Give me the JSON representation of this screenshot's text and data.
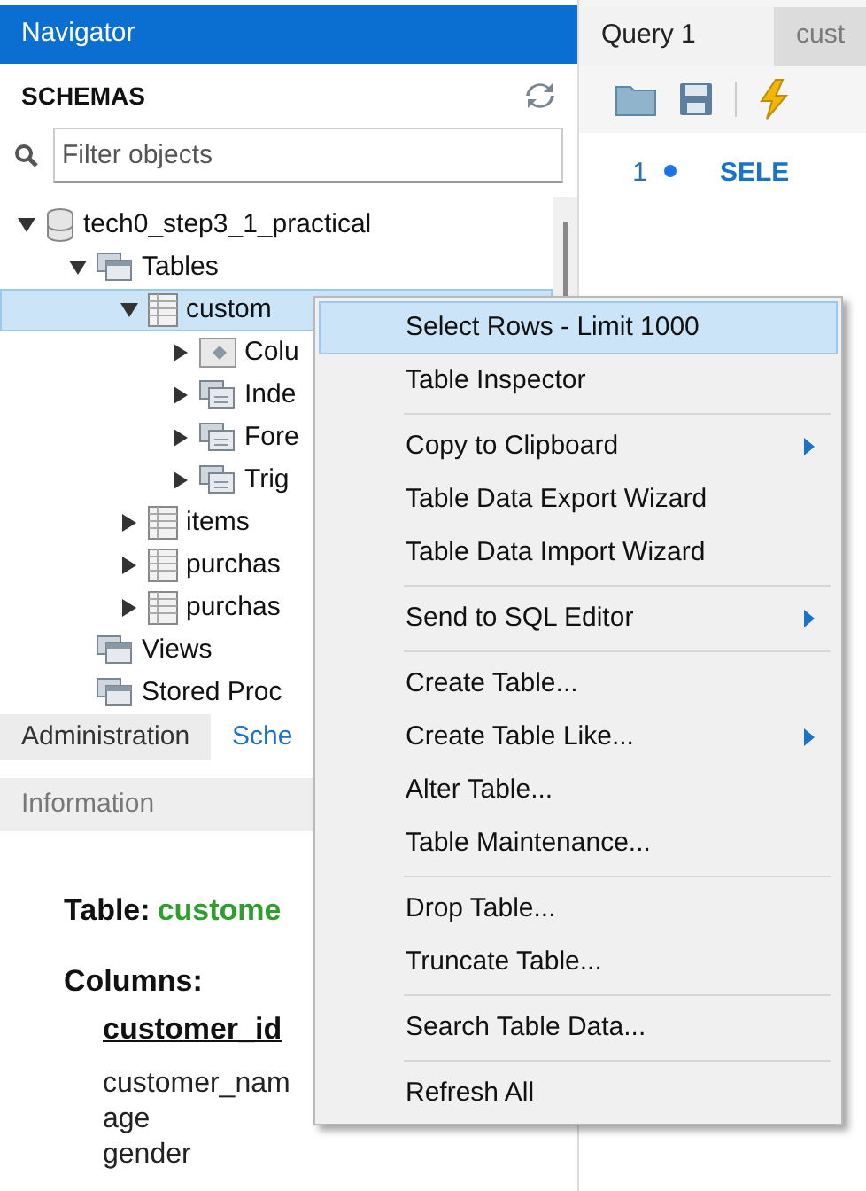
{
  "navigator": {
    "title": "Navigator",
    "section": "SCHEMAS",
    "filter": {
      "placeholder": "Filter objects"
    },
    "tree": [
      {
        "label": "tech0_step3_1_practical",
        "kind": "schema",
        "expanded": true,
        "selected": false,
        "children": [
          {
            "label": "Tables",
            "kind": "group",
            "expanded": true,
            "selected": false,
            "children": [
              {
                "label": "custom",
                "kind": "table",
                "expanded": true,
                "selected": true,
                "children": [
                  {
                    "label": "Colu",
                    "kind": "columns",
                    "expanded": false,
                    "selected": false
                  },
                  {
                    "label": "Inde",
                    "kind": "indexes",
                    "expanded": false,
                    "selected": false
                  },
                  {
                    "label": "Fore",
                    "kind": "foreign",
                    "expanded": false,
                    "selected": false
                  },
                  {
                    "label": "Trig",
                    "kind": "triggers",
                    "expanded": false,
                    "selected": false
                  }
                ]
              },
              {
                "label": "items",
                "kind": "table",
                "expanded": false,
                "selected": false
              },
              {
                "label": "purchas",
                "kind": "table",
                "expanded": false,
                "selected": false
              },
              {
                "label": "purchas",
                "kind": "table",
                "expanded": false,
                "selected": false
              }
            ]
          },
          {
            "label": "Views",
            "kind": "group",
            "selected": false
          },
          {
            "label": "Stored Proc",
            "kind": "group",
            "selected": false
          }
        ]
      }
    ],
    "bottom_tabs": [
      {
        "label": "Administration",
        "selected": false
      },
      {
        "label": "Sche",
        "selected": true
      }
    ]
  },
  "information": {
    "title": "Information",
    "table_label": "Table:",
    "table_name": "custome",
    "columns_label": "Columns:",
    "columns": [
      {
        "name": "customer_id",
        "primary": true
      },
      {
        "name": "customer_nam",
        "primary": false
      },
      {
        "name": "age",
        "primary": false
      },
      {
        "name": "gender",
        "primary": false
      }
    ]
  },
  "editor": {
    "tabs": [
      {
        "label": "Query 1",
        "selected": true
      },
      {
        "label": "cust",
        "selected": false
      }
    ],
    "line_number": "1",
    "code": "SELE"
  },
  "context_menu": [
    {
      "kind": "item",
      "label": "Select Rows - Limit 1000",
      "selected": true,
      "submenu": false
    },
    {
      "kind": "item",
      "label": "Table Inspector",
      "selected": false,
      "submenu": false
    },
    {
      "kind": "separator"
    },
    {
      "kind": "item",
      "label": "Copy to Clipboard",
      "selected": false,
      "submenu": true
    },
    {
      "kind": "item",
      "label": "Table Data Export Wizard",
      "selected": false,
      "submenu": false
    },
    {
      "kind": "item",
      "label": "Table Data Import Wizard",
      "selected": false,
      "submenu": false
    },
    {
      "kind": "separator"
    },
    {
      "kind": "item",
      "label": "Send to SQL Editor",
      "selected": false,
      "submenu": true
    },
    {
      "kind": "separator"
    },
    {
      "kind": "item",
      "label": "Create Table...",
      "selected": false,
      "submenu": false
    },
    {
      "kind": "item",
      "label": "Create Table Like...",
      "selected": false,
      "submenu": true
    },
    {
      "kind": "item",
      "label": "Alter Table...",
      "selected": false,
      "submenu": false
    },
    {
      "kind": "item",
      "label": "Table Maintenance...",
      "selected": false,
      "submenu": false
    },
    {
      "kind": "separator"
    },
    {
      "kind": "item",
      "label": "Drop Table...",
      "selected": false,
      "submenu": false
    },
    {
      "kind": "item",
      "label": "Truncate Table...",
      "selected": false,
      "submenu": false
    },
    {
      "kind": "separator"
    },
    {
      "kind": "item",
      "label": "Search Table Data...",
      "selected": false,
      "submenu": false
    },
    {
      "kind": "separator"
    },
    {
      "kind": "item",
      "label": "Refresh All",
      "selected": false,
      "submenu": false
    }
  ]
}
